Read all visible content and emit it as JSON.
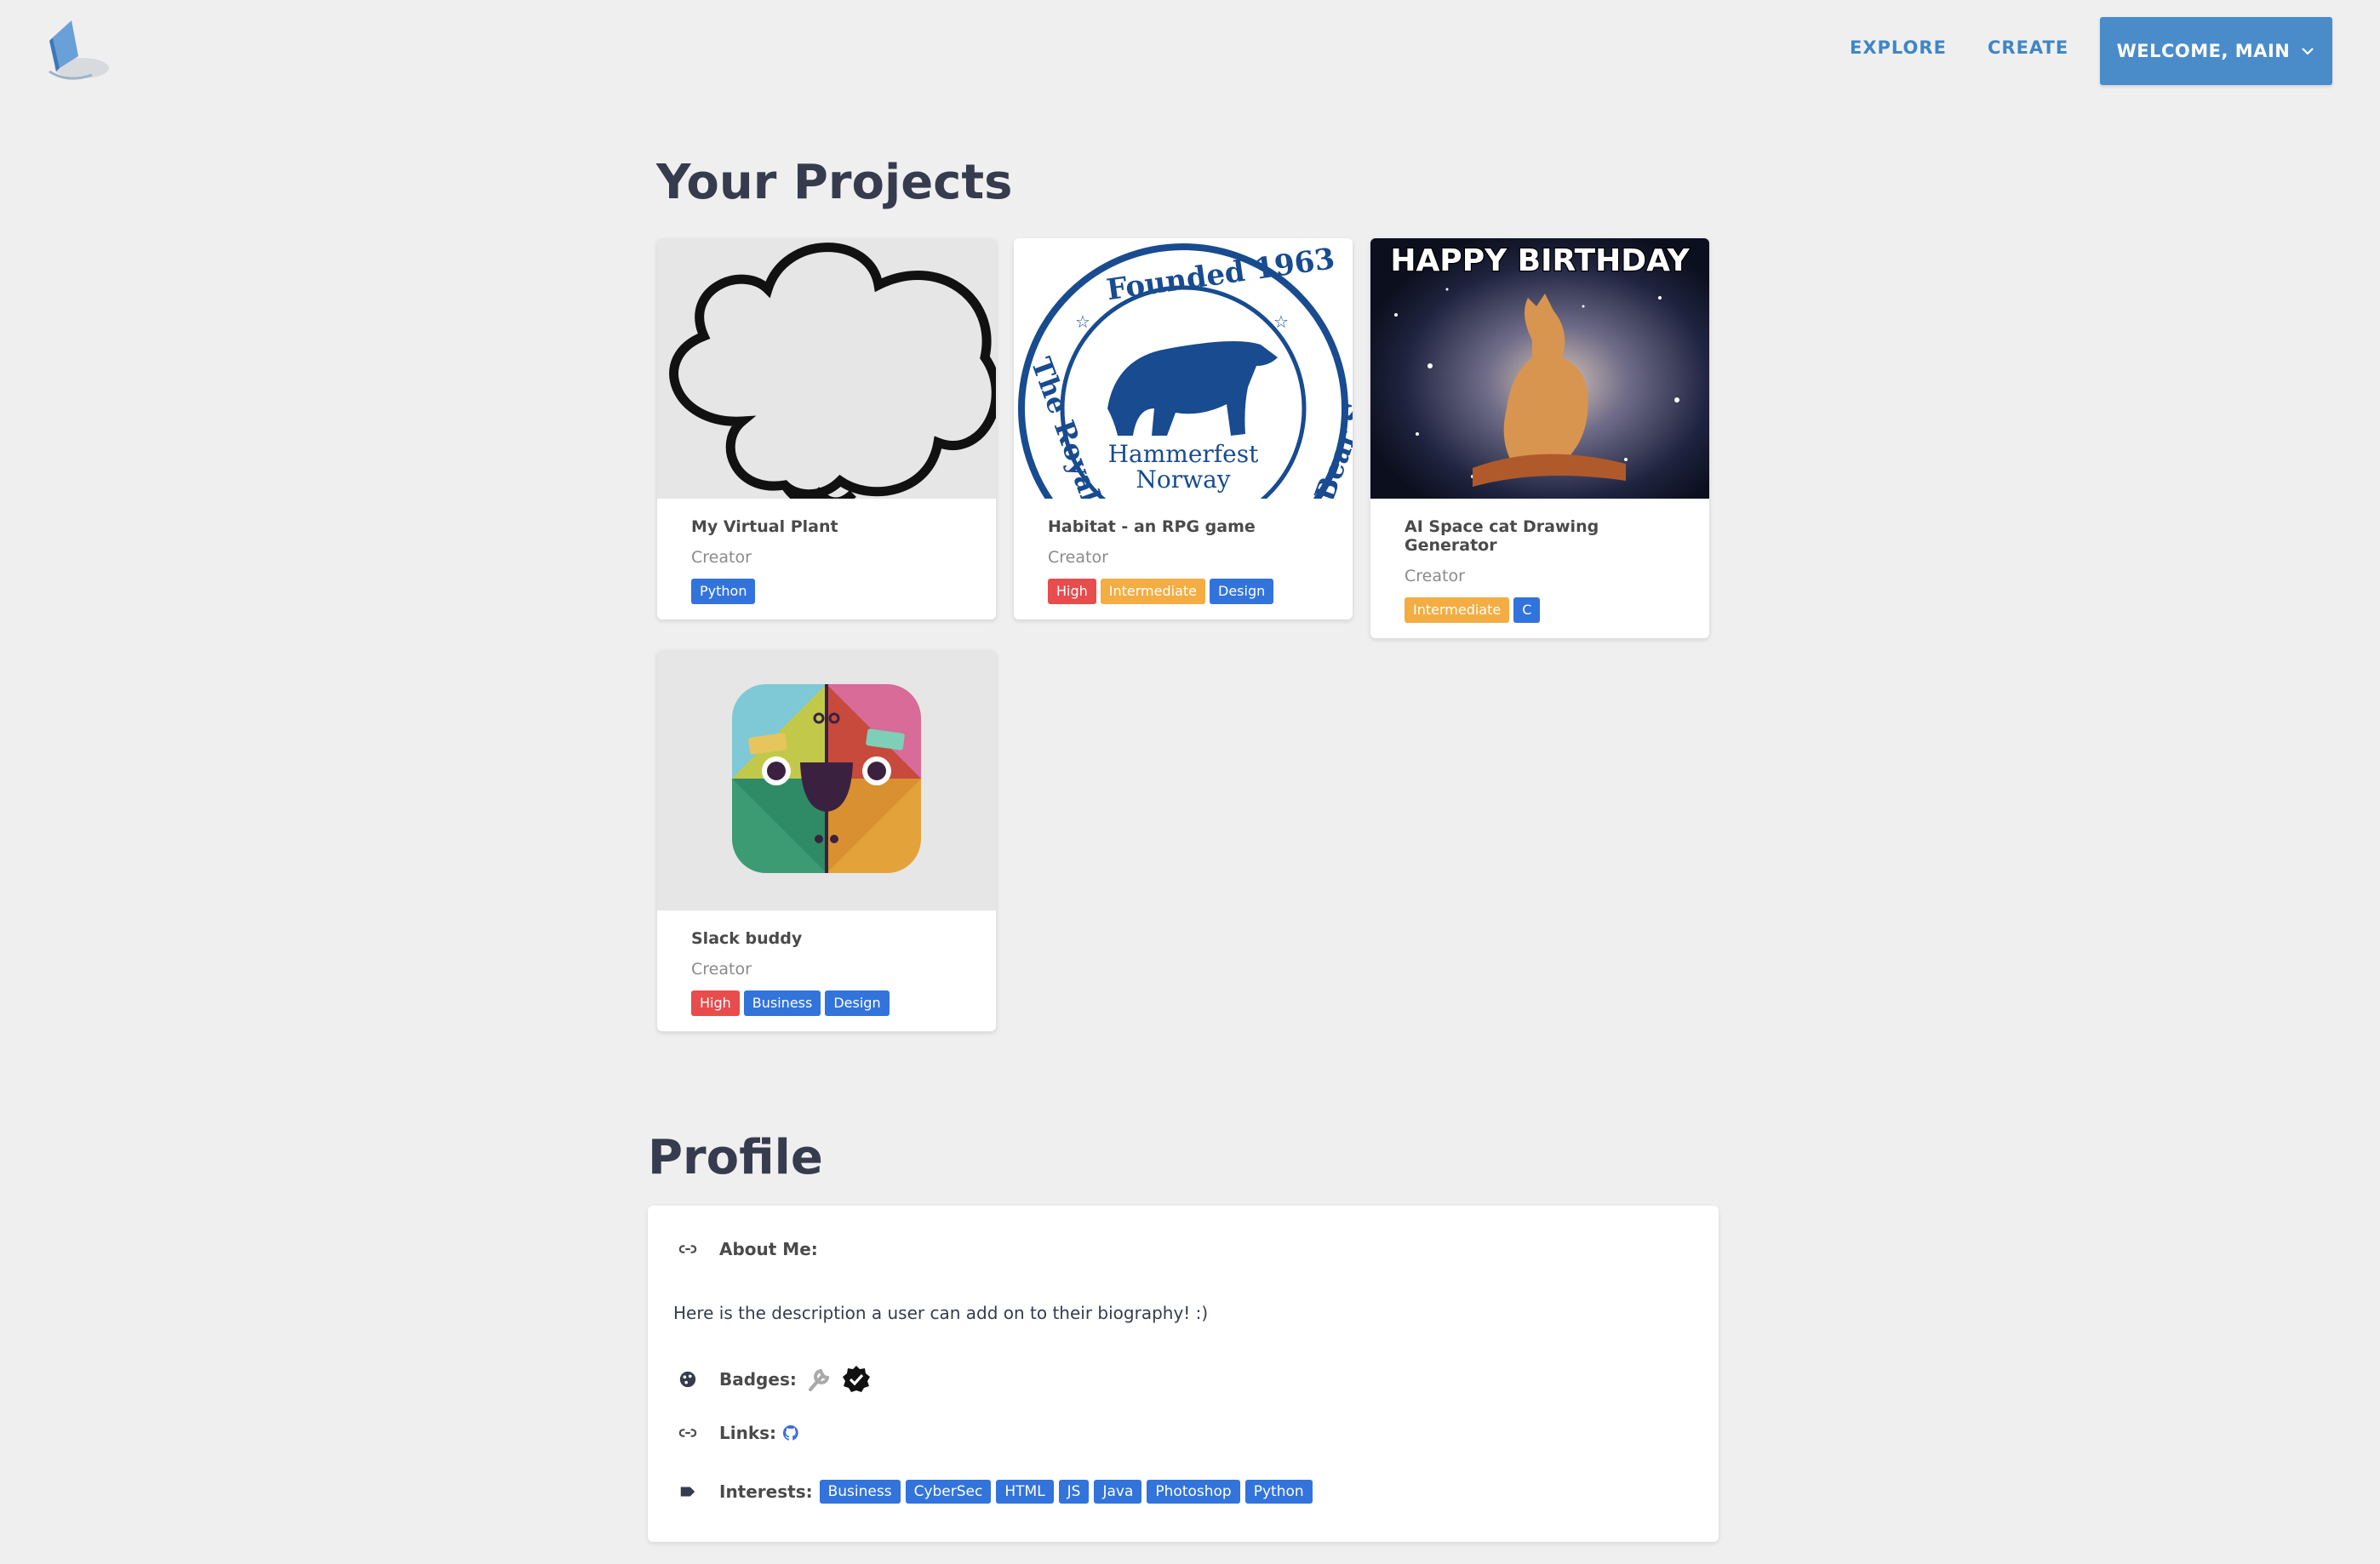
{
  "nav": {
    "logo_icon": "laptop-logo-icon",
    "explore_label": "EXPLORE",
    "create_label": "CREATE",
    "user_menu_label": "WELCOME, MAIN",
    "user_menu_icon": "chevron-down-icon",
    "accent_color": "#4a8cca"
  },
  "projects": {
    "title": "Your Projects",
    "cards": [
      {
        "name": "My Virtual Plant",
        "role": "Creator",
        "image": "cloud-outline-image",
        "tags": [
          {
            "label": "Python",
            "color": "blue"
          }
        ]
      },
      {
        "name": "Habitat - an RPG game",
        "role": "Creator",
        "image": "polar-bear-society-seal-image",
        "seal_text": [
          "Founded 1963",
          "The Royal",
          "Bear Society",
          "Hammerfest",
          "Norway"
        ],
        "tags": [
          {
            "label": "High",
            "color": "red"
          },
          {
            "label": "Intermediate",
            "color": "orange"
          },
          {
            "label": "Design",
            "color": "blue"
          }
        ]
      },
      {
        "name": "AI Space cat Drawing Generator",
        "role": "Creator",
        "image": "space-cat-meme-image",
        "image_caption": "HAPPY BIRTHDAY",
        "tags": [
          {
            "label": "Intermediate",
            "color": "orange"
          },
          {
            "label": "C",
            "color": "blue"
          }
        ]
      },
      {
        "name": "Slack buddy",
        "role": "Creator",
        "image": "slack-buddy-face-image",
        "tags": [
          {
            "label": "High",
            "color": "red"
          },
          {
            "label": "Business",
            "color": "blue"
          },
          {
            "label": "Design",
            "color": "blue"
          }
        ]
      }
    ]
  },
  "profile": {
    "title": "Profile",
    "about_label": "About Me:",
    "about_icon": "link-icon",
    "bio": "Here is the description a user can add on to their biography! :)",
    "badges_label": "Badges:",
    "badges_icon": "palette-icon",
    "badges": [
      "wrench-badge-icon",
      "verified-check-badge-icon"
    ],
    "links_label": "Links:",
    "links_icon": "link-icon",
    "links": [
      "github-icon"
    ],
    "interests_label": "Interests:",
    "interests_icon": "tag-icon",
    "interests": [
      "Business",
      "CyberSec",
      "HTML",
      "JS",
      "Java",
      "Photoshop",
      "Python"
    ]
  },
  "colors": {
    "tag_blue": "#3273dc",
    "tag_red": "#e84c4c",
    "tag_orange": "#f4ad42",
    "heading": "#363b4e"
  }
}
